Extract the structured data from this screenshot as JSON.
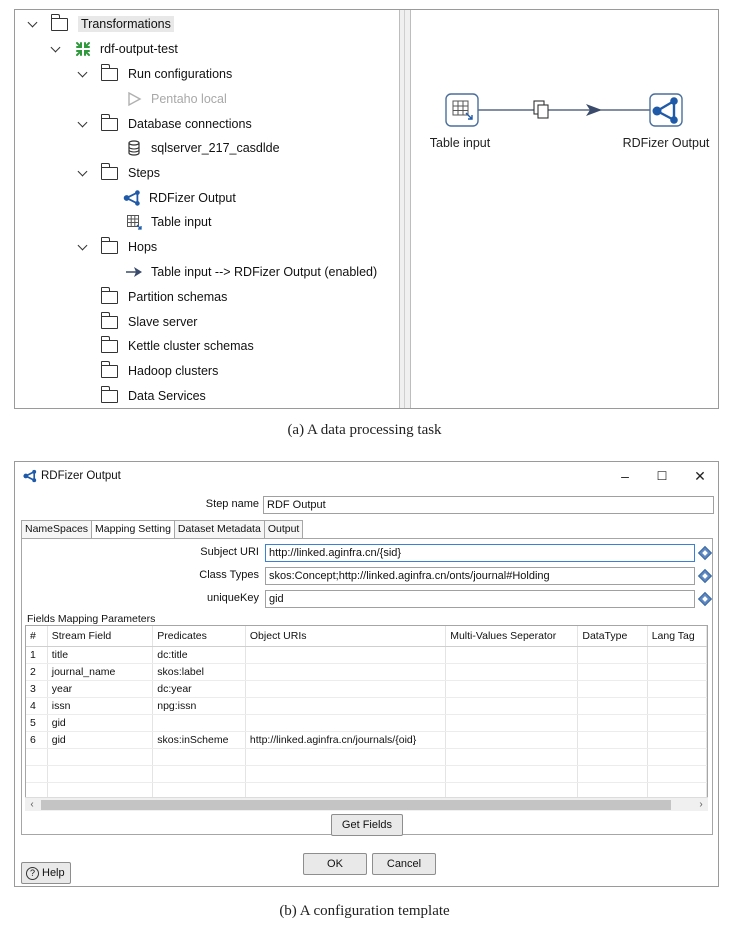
{
  "panel_a": {
    "tree": {
      "root": "Transformations",
      "transformation": "rdf-output-test",
      "run_configurations": {
        "label": "Run configurations",
        "items": [
          "Pentaho local"
        ]
      },
      "database_connections": {
        "label": "Database connections",
        "items": [
          "sqlserver_217_casdlde"
        ]
      },
      "steps": {
        "label": "Steps",
        "items": [
          "RDFizer Output",
          "Table input"
        ]
      },
      "hops": {
        "label": "Hops",
        "items": [
          "Table input --> RDFizer Output (enabled)"
        ]
      },
      "partition_schemas": "Partition schemas",
      "slave_server": "Slave server",
      "kettle_cluster_schemas": "Kettle cluster schemas",
      "hadoop_clusters": "Hadoop clusters",
      "data_services": "Data Services"
    },
    "canvas": {
      "step1": "Table input",
      "step2": "RDFizer Output"
    },
    "caption": "(a) A data processing task"
  },
  "panel_b": {
    "window_title": "RDFizer Output",
    "window_buttons": {
      "minimize": "–",
      "maximize": "☐",
      "close": "✕"
    },
    "step_name_label": "Step name",
    "step_name_value": "RDF Output",
    "tabs": [
      "NameSpaces",
      "Mapping Setting",
      "Dataset Metadata",
      "Output"
    ],
    "subject_uri_label": "Subject URI",
    "subject_uri_value": "http://linked.aginfra.cn/{sid}",
    "class_types_label": "Class Types",
    "class_types_value": "skos:Concept;http://linked.aginfra.cn/onts/journal#Holding",
    "unique_key_label": "uniqueKey",
    "unique_key_value": "gid",
    "fields_section_label": "Fields Mapping Parameters",
    "table": {
      "columns": [
        "#",
        "Stream Field",
        "Predicates",
        "Object URIs",
        "Multi-Values Seperator",
        "DataType",
        "Lang Tag"
      ],
      "rows": [
        [
          "1",
          "title",
          "dc:title",
          "",
          "",
          "",
          ""
        ],
        [
          "2",
          "journal_name",
          "skos:label",
          "",
          "",
          "",
          ""
        ],
        [
          "3",
          "year",
          "dc:year",
          "",
          "",
          "",
          ""
        ],
        [
          "4",
          "issn",
          "npg:issn",
          "",
          "",
          "",
          ""
        ],
        [
          "5",
          "gid",
          "",
          "",
          "",
          "",
          ""
        ],
        [
          "6",
          "gid",
          "skos:inScheme",
          "http://linked.aginfra.cn/journals/{oid}",
          "",
          "",
          ""
        ]
      ]
    },
    "get_fields_button": "Get Fields",
    "ok_button": "OK",
    "cancel_button": "Cancel",
    "help_button": "Help",
    "caption": "(b) A configuration template"
  }
}
